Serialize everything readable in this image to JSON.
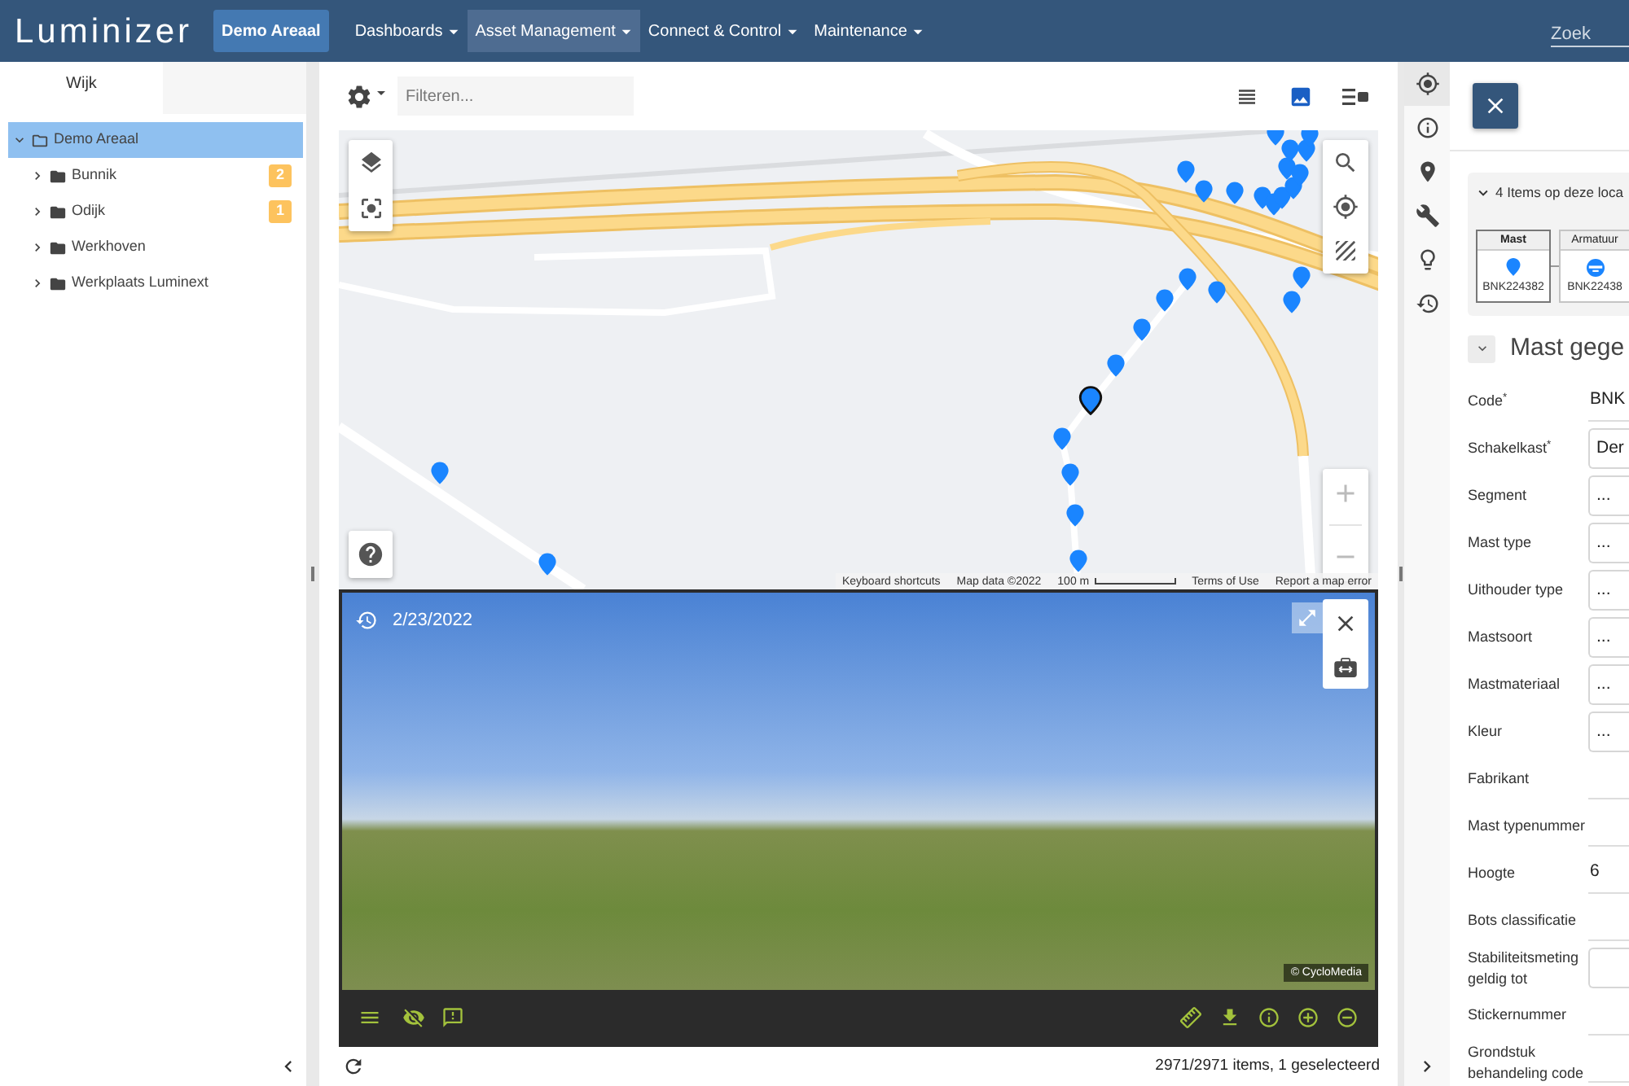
{
  "nav": {
    "logo": "Luminizer",
    "area_button": "Demo Areaal",
    "menus": [
      {
        "label": "Dashboards",
        "selected": false
      },
      {
        "label": "Asset Management",
        "selected": true
      },
      {
        "label": "Connect & Control",
        "selected": false
      },
      {
        "label": "Maintenance",
        "selected": false
      }
    ],
    "search": {
      "placeholder": "Zoek"
    }
  },
  "sidebar": {
    "tabs": [
      {
        "label": "Wijk",
        "selected": true
      }
    ],
    "tree": [
      {
        "label": "Demo Areaal",
        "expanded": true,
        "selected": true,
        "children": [
          {
            "label": "Bunnik",
            "expanded": false,
            "selected": false,
            "badge": "2"
          },
          {
            "label": "Odijk",
            "expanded": false,
            "selected": false,
            "badge": "1"
          },
          {
            "label": "Werkhoven",
            "expanded": false,
            "selected": false
          },
          {
            "label": "Werkplaats Luminext",
            "expanded": false,
            "selected": false
          }
        ]
      }
    ]
  },
  "toolbar": {
    "filter": {
      "placeholder": "Filteren..."
    },
    "views": [
      {
        "kind": "list",
        "selected": false
      },
      {
        "kind": "image",
        "selected": true
      },
      {
        "kind": "split",
        "selected": false
      }
    ]
  },
  "map": {
    "footer": [
      {
        "kind": "link",
        "text": "Keyboard shortcuts"
      },
      {
        "kind": "text",
        "text": "Map data ©2022"
      },
      {
        "kind": "scale",
        "text": "100 m"
      },
      {
        "kind": "link",
        "text": "Terms of Use"
      },
      {
        "kind": "link",
        "text": "Report a map error"
      }
    ]
  },
  "street_view": {
    "date": "2/23/2022",
    "credit": "© CycloMedia"
  },
  "status_bar": {
    "summary": "2971/2971 items, 1 geselecteerd"
  },
  "side_tools": [
    {
      "kind": "target",
      "selected": true
    },
    {
      "kind": "info",
      "selected": false
    },
    {
      "kind": "place",
      "selected": false
    },
    {
      "kind": "wrench",
      "selected": false
    },
    {
      "kind": "bulb",
      "selected": false
    },
    {
      "kind": "history",
      "selected": false
    }
  ],
  "details": {
    "location": {
      "title": "4 Items op deze loca",
      "expanded": true,
      "items": [
        {
          "type": "Mast",
          "code": "BNK224382",
          "kind": "pole",
          "selected": true
        },
        {
          "type": "Armatuur",
          "code": "BNK22438",
          "kind": "lamp",
          "selected": false
        }
      ]
    },
    "section": {
      "title": "Mast gege",
      "expanded": true
    },
    "fields": [
      {
        "label": "Code$^{*}$",
        "kind": "text",
        "value": "BNK"
      },
      {
        "label": "Schakelkast$^{*}$",
        "kind": "select",
        "value": "Der"
      },
      {
        "label": "Segment",
        "kind": "select",
        "value": "..."
      },
      {
        "label": "Mast type",
        "kind": "select",
        "value": "..."
      },
      {
        "label": "Uithouder type",
        "kind": "select",
        "value": "..."
      },
      {
        "label": "Mastsoort",
        "kind": "select",
        "value": "..."
      },
      {
        "label": "Mastmateriaal",
        "kind": "select",
        "value": "..."
      },
      {
        "label": "Kleur",
        "kind": "select",
        "value": "..."
      },
      {
        "label": "Fabrikant",
        "kind": "text"
      },
      {
        "label": "Mast typenummer",
        "kind": "text"
      },
      {
        "label": "Hoogte",
        "kind": "text",
        "value": "6"
      },
      {
        "label": "Bots classificatie",
        "kind": "text"
      },
      {
        "label": "Stabiliteitsmeting geldig tot",
        "kind": "input"
      },
      {
        "label": "Stickernummer",
        "kind": "text"
      },
      {
        "label": "Grondstuk behandeling code",
        "kind": "text"
      }
    ]
  }
}
